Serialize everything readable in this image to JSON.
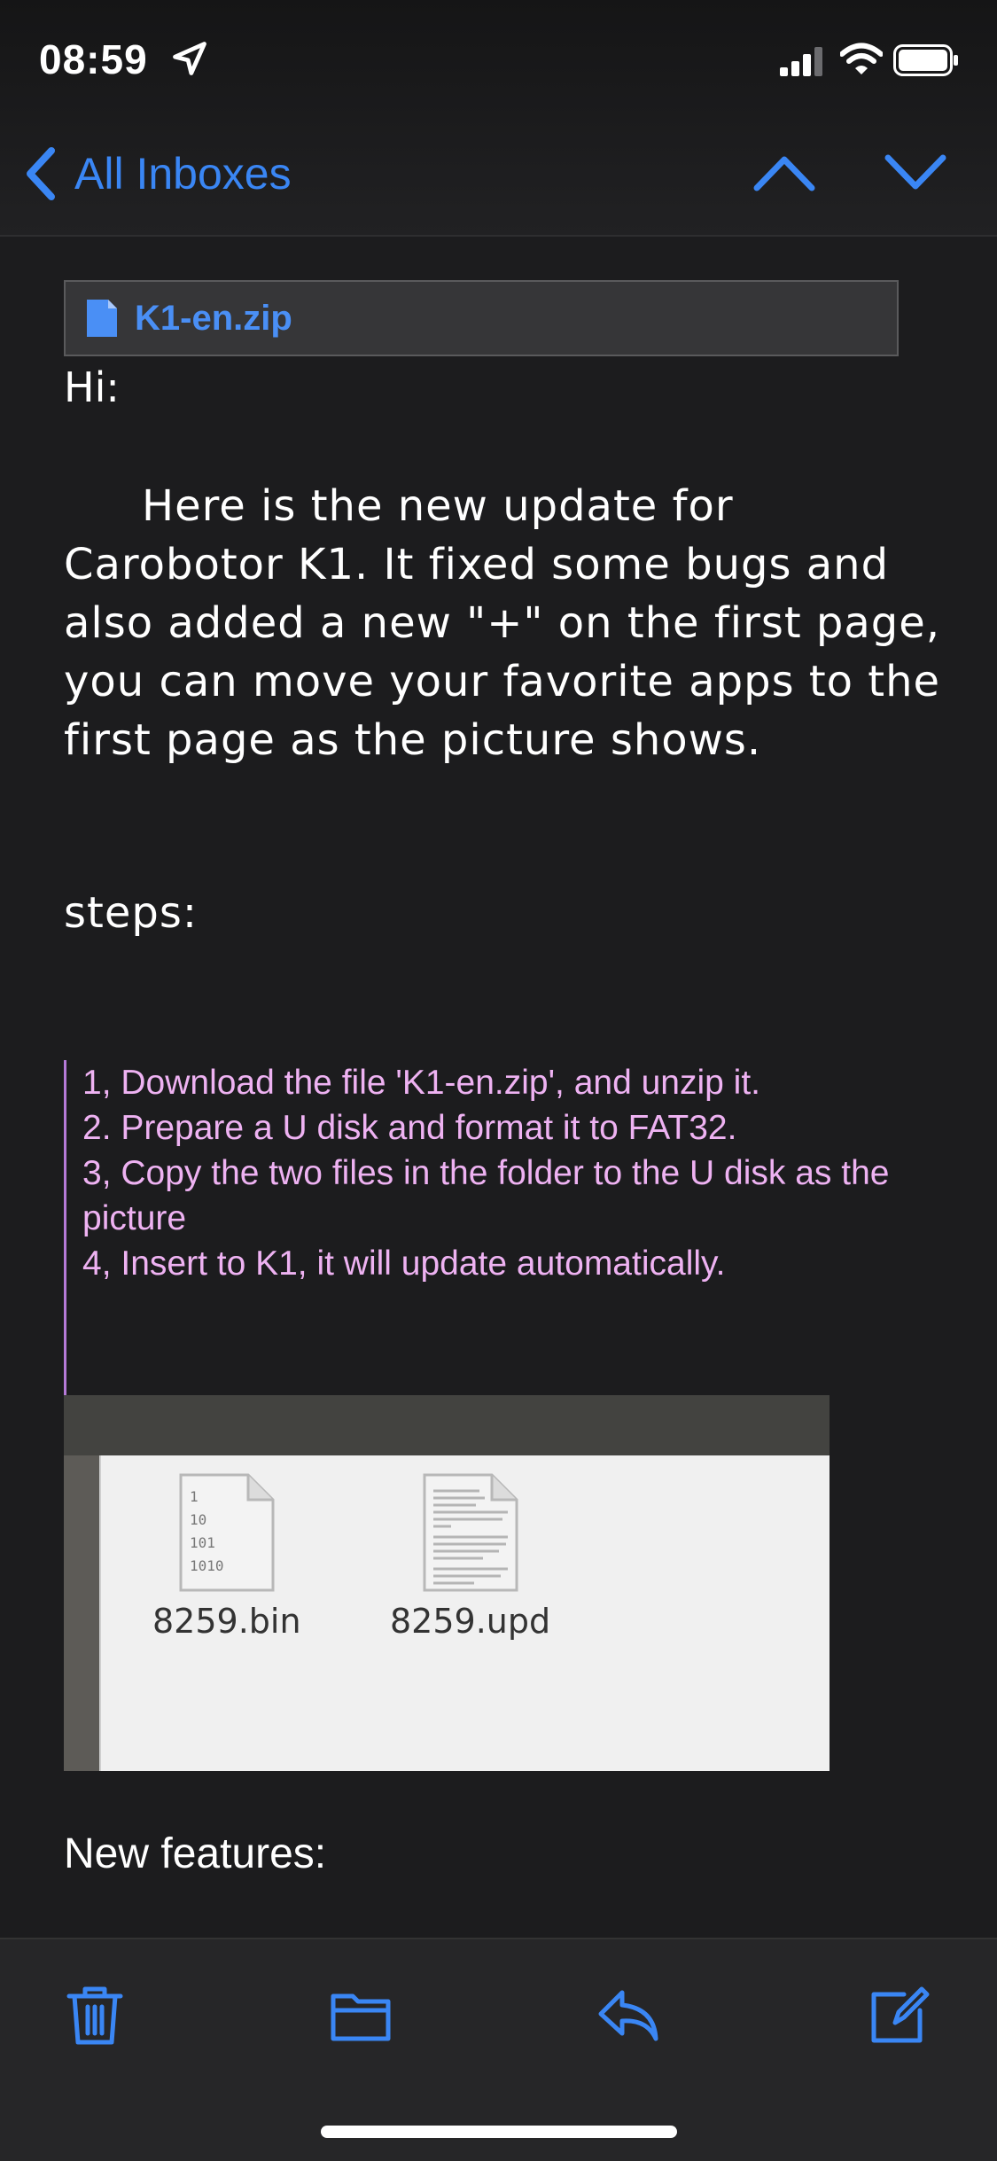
{
  "status_bar": {
    "time": "08:59"
  },
  "nav": {
    "back_label": "All Inboxes"
  },
  "attachment": {
    "name": "K1-en.zip"
  },
  "email": {
    "greeting": "Hi:",
    "paragraph": "Here is the new update for Carobotor K1. It fixed some bugs and also added a new \"+\" on the first page, you can move your favorite apps to the first page as the picture shows.",
    "steps_label": "steps:",
    "steps": [
      "1, Download the file 'K1-en.zip', and unzip it.",
      "2. Prepare a U disk and format it to FAT32.",
      "3, Copy the two files in the folder to the U disk as the picture",
      "4, Insert to K1, it will update automatically."
    ],
    "picture_files": [
      {
        "name": "8259.bin",
        "icon": "binary-file-icon",
        "glyph_lines": [
          "1",
          "10",
          "101",
          "1010"
        ]
      },
      {
        "name": "8259.upd",
        "icon": "text-file-icon"
      }
    ],
    "new_features_label": "New features:"
  },
  "toolbar": {
    "items": [
      "trash-icon",
      "folder-icon",
      "reply-icon",
      "compose-icon"
    ]
  },
  "colors": {
    "accent": "#3a86f4",
    "quote_text": "#eeb2f2",
    "quote_bar": "#b57ad8",
    "background": "#1c1c1e"
  }
}
